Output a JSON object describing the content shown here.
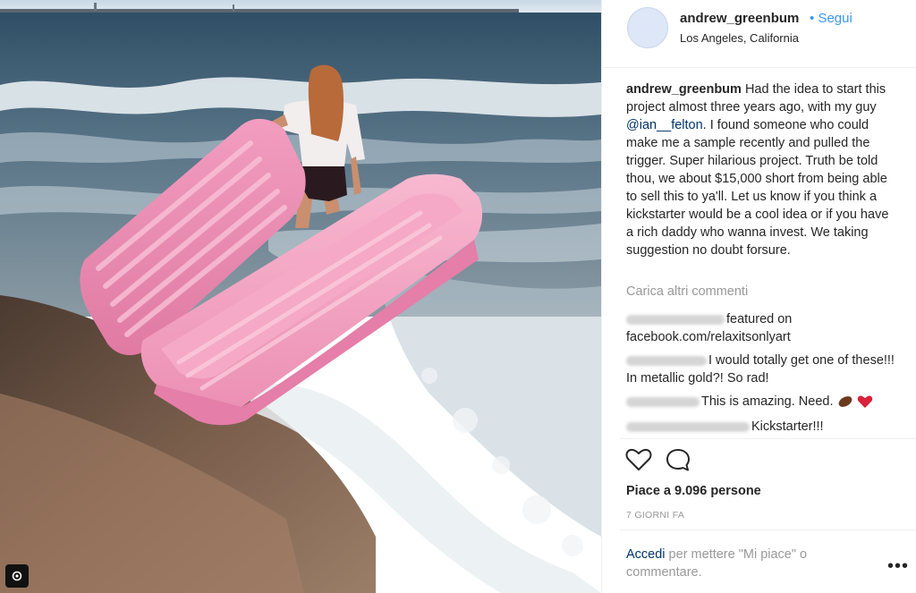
{
  "post": {
    "username": "andrew_greenbum",
    "follow_separator": "•",
    "follow_label": "Segui",
    "location": "Los Angeles, California",
    "caption": {
      "username": "andrew_greenbum",
      "text_before_mention": "Had the idea to start this project almost three years ago, with my guy ",
      "mention": "@ian__felton",
      "text_after_mention": ". I found someone who could make me a sample recently and pulled the trigger. Super hilarious project. Truth be told thou, we about $15,000 short from being able to sell this to ya'll. Let us know if you think a kickstarter would be a cool idea or if you have a rich daddy who wanna invest. We taking suggestion no doubt forsure."
    },
    "load_more_comments": "Carica altri commenti",
    "comments": [
      {
        "text": "featured on facebook.com/relaxitsonlyart"
      },
      {
        "text": "I would totally get one of these!!! In metallic gold?! So rad!"
      },
      {
        "text": "This is amazing. Need."
      },
      {
        "text": "Kickstarter!!!"
      }
    ],
    "likes_text": "Piace a 9.096 persone",
    "time_ago": "7 GIORNI FA",
    "login_link": "Accedi",
    "login_text": " per mettere \"Mi piace\" o commentare.",
    "more_options": "•••"
  },
  "icons": {
    "like": "heart-outline-icon",
    "comment": "speech-bubble-icon",
    "emoji_1": "brown-emoji-icon",
    "emoji_2": "red-heart-icon",
    "corner": "instagram-badge-icon"
  },
  "colors": {
    "link_blue": "#3897f0",
    "mention_blue": "#003569",
    "text": "#262626",
    "muted": "#999999",
    "coffin_pink": "#f4a3c3"
  }
}
